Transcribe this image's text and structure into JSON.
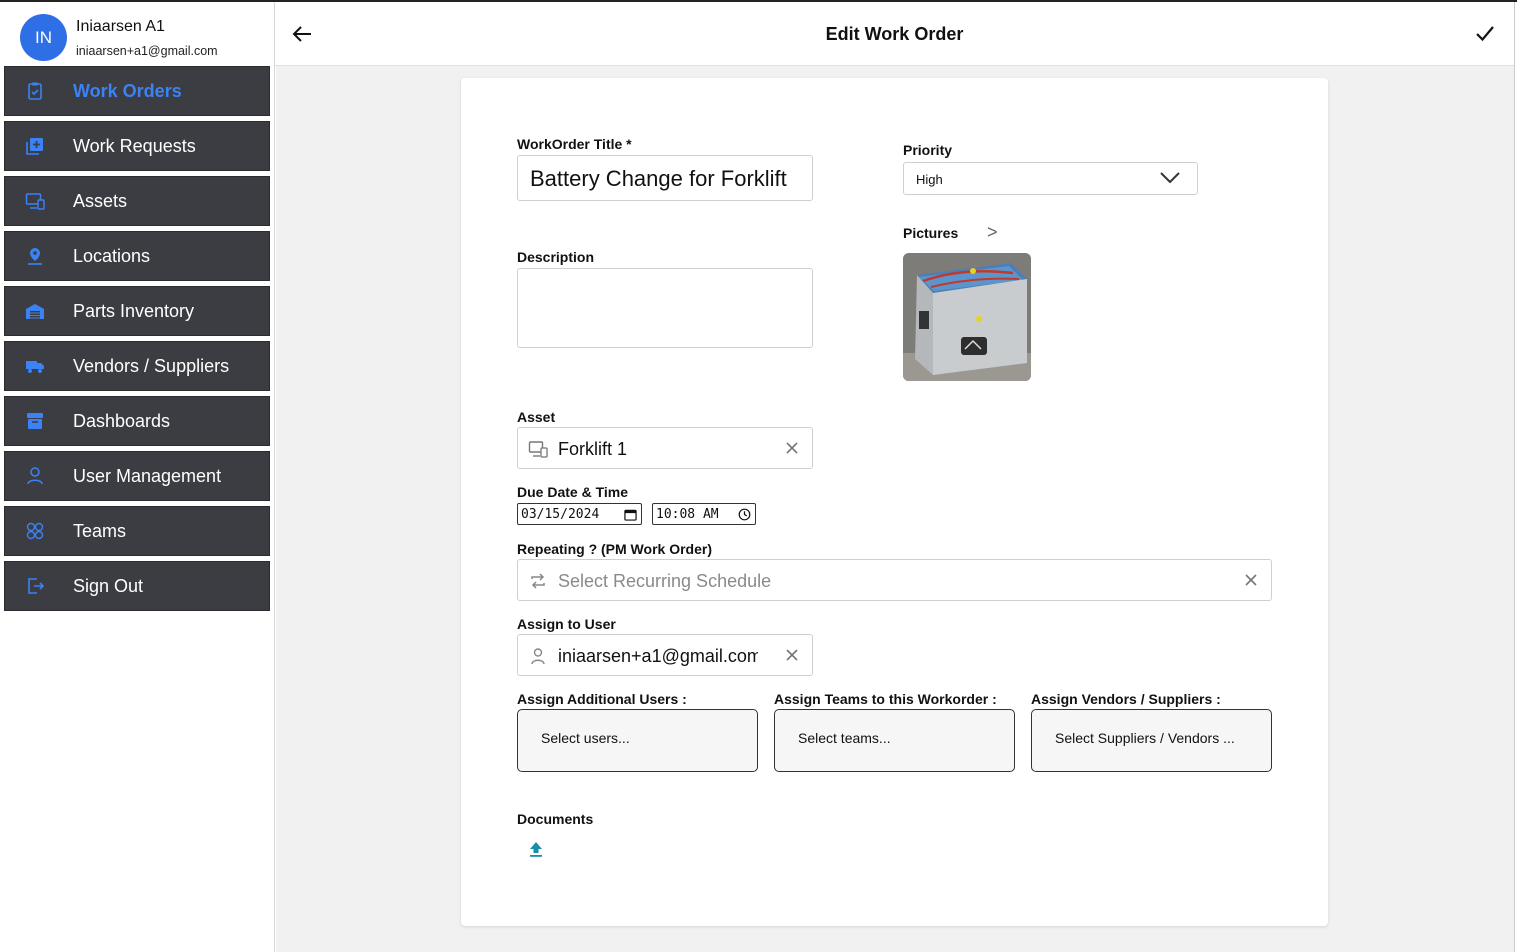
{
  "profile": {
    "initials": "IN",
    "name": "Iniaarsen A1",
    "email": "iniaarsen+a1@gmail.com"
  },
  "nav": [
    {
      "label": "Work Orders",
      "icon": "clipboard-check-icon",
      "active": true
    },
    {
      "label": "Work Requests",
      "icon": "add-box-icon"
    },
    {
      "label": "Assets",
      "icon": "monitor-asset-icon"
    },
    {
      "label": "Locations",
      "icon": "location-pin-icon"
    },
    {
      "label": "Parts Inventory",
      "icon": "warehouse-icon"
    },
    {
      "label": "Vendors / Suppliers",
      "icon": "truck-icon"
    },
    {
      "label": "Dashboards",
      "icon": "archive-icon"
    },
    {
      "label": "User Management",
      "icon": "user-icon"
    },
    {
      "label": "Teams",
      "icon": "team-icon"
    },
    {
      "label": "Sign Out",
      "icon": "sign-out-icon"
    }
  ],
  "header": {
    "title": "Edit Work Order"
  },
  "form": {
    "title_label": "WorkOrder Title *",
    "title_value": "Battery Change for Forklift",
    "description_label": "Description",
    "description_value": "",
    "priority_label": "Priority",
    "priority_value": "High",
    "pictures_label": "Pictures",
    "pictures_arrow": ">",
    "asset_label": "Asset",
    "asset_value": "Forklift 1",
    "due_label": "Due Date & Time",
    "due_date": "03/15/2024",
    "due_time": "10:08 AM",
    "repeat_label": "Repeating ? (PM Work Order)",
    "repeat_placeholder": "Select Recurring Schedule",
    "assign_user_label": "Assign to User",
    "assign_user_value": "iniaarsen+a1@gmail.com",
    "additional_users_label": "Assign Additional Users :",
    "additional_users_placeholder": "Select users...",
    "teams_label": "Assign Teams to this Workorder :",
    "teams_placeholder": "Select teams...",
    "vendors_label": "Assign Vendors / Suppliers :",
    "vendors_placeholder": "Select Suppliers / Vendors ...",
    "documents_label": "Documents"
  },
  "colors": {
    "accent": "#3b82f6",
    "avatar": "#2f6fe6",
    "nav_bg": "#3c3d42",
    "upload": "#1a8fa8"
  }
}
